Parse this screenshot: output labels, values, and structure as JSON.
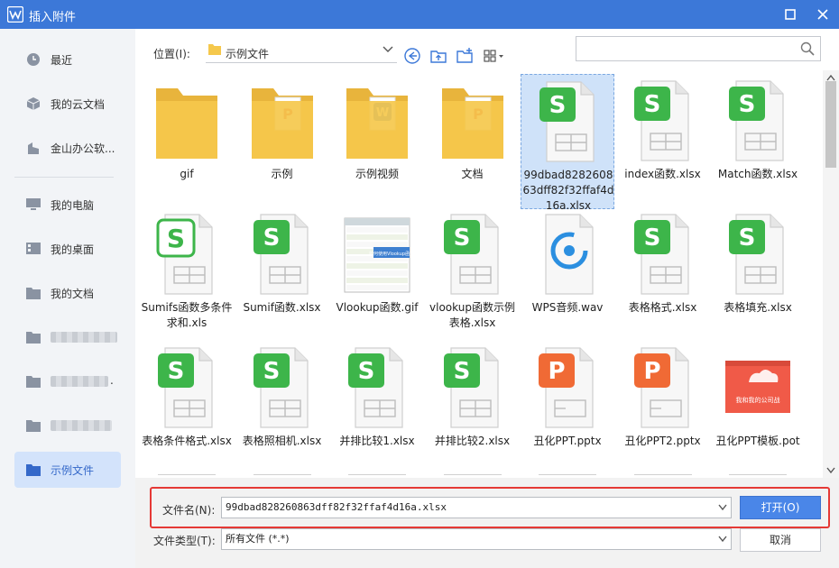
{
  "window": {
    "title": "插入附件"
  },
  "sidebar": {
    "items": [
      {
        "label": "最近",
        "icon": "clock-icon"
      },
      {
        "label": "我的云文档",
        "icon": "cube-icon"
      },
      {
        "label": "金山办公软...",
        "icon": "building-icon"
      },
      {
        "label": "我的电脑",
        "icon": "monitor-icon"
      },
      {
        "label": "我的桌面",
        "icon": "desktop-icon"
      },
      {
        "label": "我的文档",
        "icon": "folder-icon"
      },
      {
        "label": "",
        "icon": "folder-icon"
      },
      {
        "label": ".",
        "icon": "folder-icon"
      },
      {
        "label": "",
        "icon": "folder-icon"
      },
      {
        "label": "示例文件",
        "icon": "folder-icon"
      }
    ]
  },
  "toolbar": {
    "location_label": "位置(I):",
    "location_value": "示例文件"
  },
  "files": [
    {
      "name": "gif",
      "type": "folder",
      "badge": ""
    },
    {
      "name": "示例",
      "type": "folder",
      "badge": "pdf"
    },
    {
      "name": "示例视频",
      "type": "folder",
      "badge": "word"
    },
    {
      "name": "文档",
      "type": "folder",
      "badge": "pdf"
    },
    {
      "name": "99dbad828260863dff82f32ffaf4d16a.xlsx",
      "type": "xlsx",
      "selected": true
    },
    {
      "name": "index函数.xlsx",
      "type": "xlsx"
    },
    {
      "name": "Match函数.xlsx",
      "type": "xlsx"
    },
    {
      "name": "Sumifs函数多条件求和.xls",
      "type": "xls"
    },
    {
      "name": "Sumif函数.xlsx",
      "type": "xlsx"
    },
    {
      "name": "Vlookup函数.gif",
      "type": "gif-thumb",
      "thumb_text": "如何使用Vlookup函数"
    },
    {
      "name": "vlookup函数示例表格.xlsx",
      "type": "xlsx"
    },
    {
      "name": "WPS音频.wav",
      "type": "wav"
    },
    {
      "name": "表格格式.xlsx",
      "type": "xlsx"
    },
    {
      "name": "表格填充.xlsx",
      "type": "xlsx"
    },
    {
      "name": "表格条件格式.xlsx",
      "type": "xlsx"
    },
    {
      "name": "表格照相机.xlsx",
      "type": "xlsx"
    },
    {
      "name": "并排比较1.xlsx",
      "type": "xlsx"
    },
    {
      "name": "并排比较2.xlsx",
      "type": "xlsx"
    },
    {
      "name": "丑化PPT.pptx",
      "type": "pptx"
    },
    {
      "name": "丑化PPT2.pptx",
      "type": "pptx"
    },
    {
      "name": "丑化PPT模板.pot",
      "type": "pot-thumb",
      "thumb_text": "我和我的公司战"
    }
  ],
  "footer": {
    "filename_label": "文件名(N):",
    "filename_value": "99dbad828260863dff82f32ffaf4d16a.xlsx",
    "filetype_label": "文件类型(T):",
    "filetype_value": "所有文件 (*.*)",
    "open_label": "打开(O)",
    "cancel_label": "取消"
  },
  "colors": {
    "titlebar": "#3c78d8",
    "spreadsheet_green": "#3db54a",
    "ppt_orange": "#f06a35",
    "folder_yellow": "#f5c84c",
    "highlight_red": "#e53935"
  }
}
